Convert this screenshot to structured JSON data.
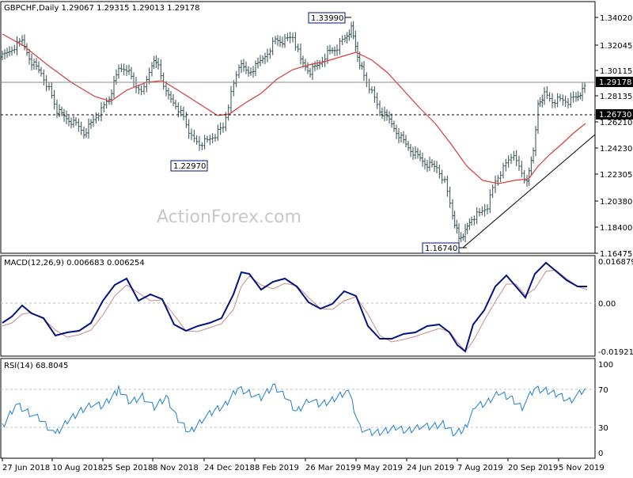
{
  "colors": {
    "bars": "#2f4f4f",
    "ma": "#d83b3b",
    "macd": "#00137f",
    "signal": "#c98a8a",
    "rsi": "#1e7fd0",
    "trendline": "#000000",
    "grid": "#bfbfbf",
    "label_bg": "#000000"
  },
  "chart_data": [
    {
      "type": "ohlc",
      "panel": "price",
      "title": "GBPCHF,Daily  1.29067 1.29315 1.29013 1.29178",
      "last_price_label": "1.29178",
      "support_label": "1.26730",
      "y_ticks": [
        "1.34020",
        "1.32045",
        "1.30115",
        "1.28135",
        "1.26210",
        "1.24230",
        "1.22305",
        "1.20380",
        "1.18400",
        "1.16475"
      ],
      "ylim": [
        1.16475,
        1.3402
      ],
      "annotations": [
        {
          "text": "1.33990",
          "date": "Apr 2019",
          "value": 1.3399
        },
        {
          "text": "1.22970",
          "date": "Dec 2018",
          "value": 1.2297
        },
        {
          "text": "1.16740",
          "date": "Aug 2019",
          "value": 1.1674
        }
      ],
      "horizontal_lines": [
        1.29178,
        1.2673
      ],
      "watermark": "ActionForex.com"
    },
    {
      "type": "line",
      "panel": "macd",
      "title": "MACD(12,26,9) 0.006683 0.006254",
      "y_ticks": [
        "0.016879",
        "0.00",
        "-0.019214"
      ],
      "ylim": [
        -0.019214,
        0.016879
      ]
    },
    {
      "type": "line",
      "panel": "rsi",
      "title": "RSI(14) 68.8045",
      "y_ticks": [
        "100",
        "70",
        "30",
        "0"
      ],
      "ylim": [
        0,
        100
      ]
    }
  ],
  "x_axis": {
    "ticks": [
      "27 Jun 2018",
      "10 Aug 2018",
      "25 Sep 2018",
      "8 Nov 2018",
      "24 Dec 2018",
      "8 Feb 2019",
      "26 Mar 2019",
      "9 May 2019",
      "24 Jun 2019",
      "7 Aug 2019",
      "20 Sep 2019",
      "5 Nov 2019"
    ]
  }
}
